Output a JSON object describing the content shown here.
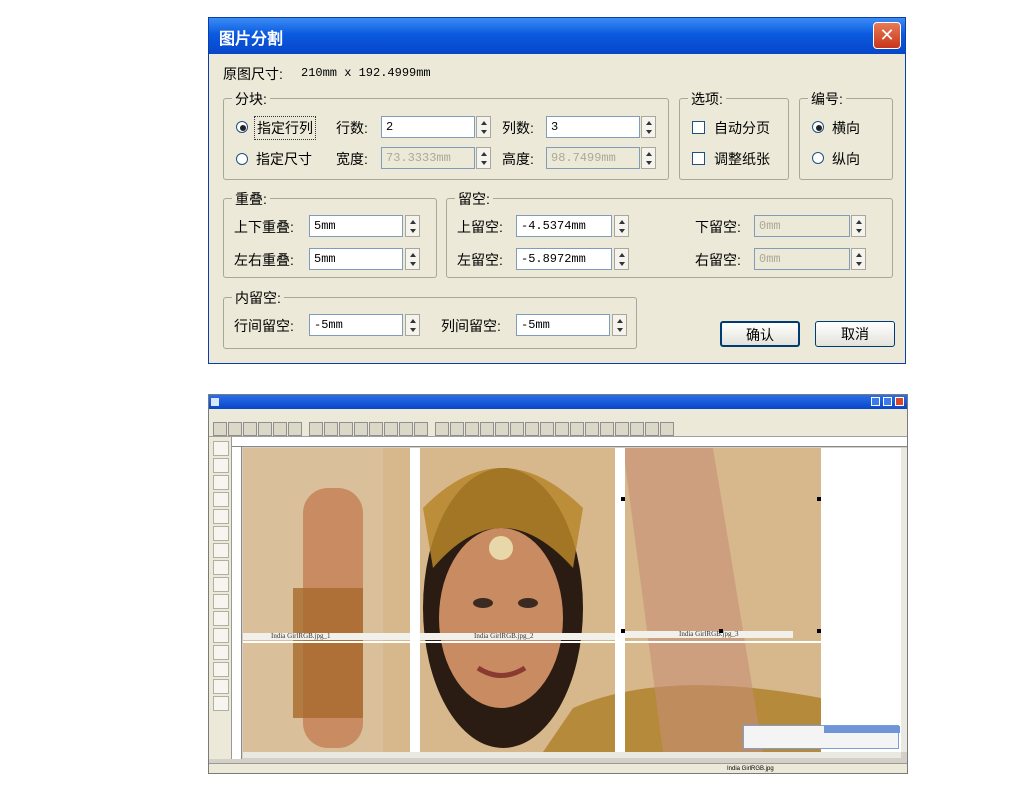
{
  "dialog": {
    "title": "图片分割",
    "original_size_label": "原图尺寸:",
    "original_size_value": "210mm x 192.4999mm",
    "blocks": {
      "title": "分块:",
      "by_rowcol_label": "指定行列",
      "by_size_label": "指定尺寸",
      "rows_label": "行数:",
      "rows_value": "2",
      "cols_label": "列数:",
      "cols_value": "3",
      "width_label": "宽度:",
      "width_value": "73.3333mm",
      "height_label": "高度:",
      "height_value": "98.7499mm"
    },
    "options": {
      "title": "选项:",
      "auto_page_label": "自动分页",
      "adjust_paper_label": "调整纸张"
    },
    "numbering": {
      "title": "编号:",
      "horizontal_label": "横向",
      "vertical_label": "纵向"
    },
    "overlap": {
      "title": "重叠:",
      "vertical_label": "上下重叠:",
      "vertical_value": "5mm",
      "horizontal_label": "左右重叠:",
      "horizontal_value": "5mm"
    },
    "margin": {
      "title": "留空:",
      "top_label": "上留空:",
      "top_value": "-4.5374mm",
      "left_label": "左留空:",
      "left_value": "-5.8972mm",
      "bottom_label": "下留空:",
      "bottom_value": "0mm",
      "right_label": "右留空:",
      "right_value": "0mm"
    },
    "inner_margin": {
      "title": "内留空:",
      "row_gap_label": "行间留空:",
      "row_gap_value": "-5mm",
      "col_gap_label": "列间留空:",
      "col_gap_value": "-5mm"
    },
    "ok_label": "确认",
    "cancel_label": "取消"
  },
  "screenshot": {
    "captions": [
      "India GirlRGB.jpg_1",
      "India GirlRGB.jpg_2",
      "India GirlRGB.jpg_3"
    ],
    "status_text": "India GirlRGB.jpg"
  },
  "colors": {
    "title_blue": "#0a5ae0",
    "dialog_bg": "#ece9d8",
    "photo_tone": "#c8a878"
  }
}
